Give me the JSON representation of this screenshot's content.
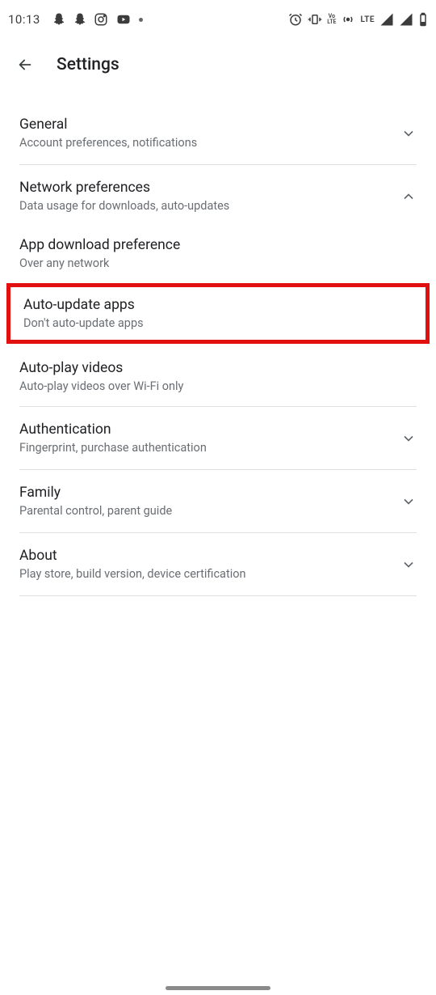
{
  "status": {
    "time": "10:13",
    "lte": "LTE"
  },
  "header": {
    "title": "Settings"
  },
  "sections": {
    "general": {
      "title": "General",
      "subtitle": "Account preferences, notifications"
    },
    "network": {
      "title": "Network preferences",
      "subtitle": "Data usage for downloads, auto-updates"
    },
    "download": {
      "title": "App download preference",
      "subtitle": "Over any network"
    },
    "autoupdate": {
      "title": "Auto-update apps",
      "subtitle": "Don't auto-update apps"
    },
    "autoplay": {
      "title": "Auto-play videos",
      "subtitle": "Auto-play videos over Wi-Fi only"
    },
    "auth": {
      "title": "Authentication",
      "subtitle": "Fingerprint, purchase authentication"
    },
    "family": {
      "title": "Family",
      "subtitle": "Parental control, parent guide"
    },
    "about": {
      "title": "About",
      "subtitle": "Play store, build version, device certification"
    }
  }
}
